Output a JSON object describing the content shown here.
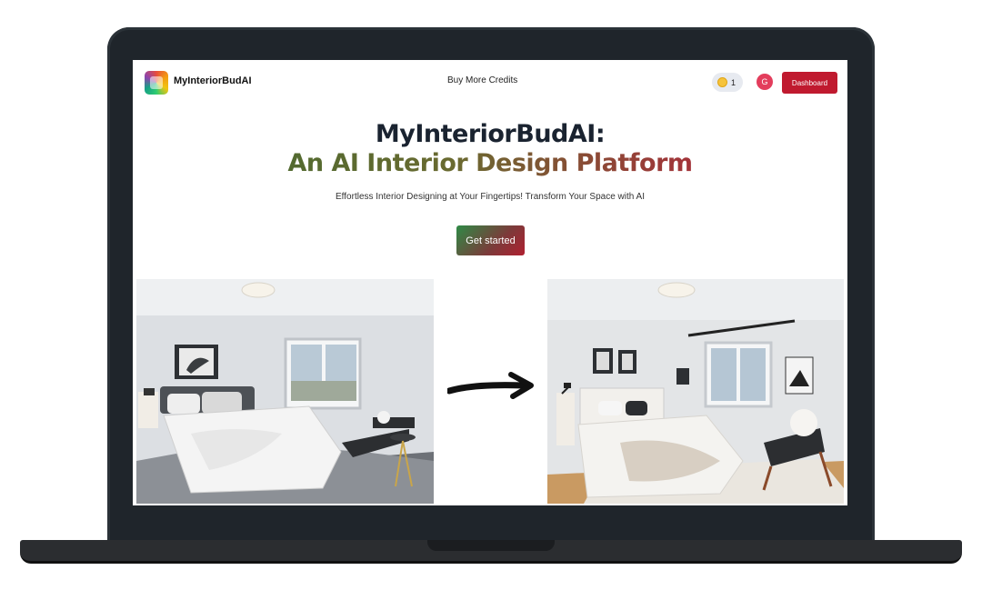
{
  "nav": {
    "brand": "MyInteriorBudAI",
    "buy_credits": "Buy More Credits",
    "credits": "1",
    "avatar_initial": "G",
    "dashboard": "Dashboard"
  },
  "hero": {
    "title": "MyInteriorBudAI:",
    "subtitle": "An AI Interior Design Platform",
    "tagline": "Effortless Interior Designing at Your Fingertips! Transform Your Space with AI",
    "cta": "Get started"
  },
  "colors": {
    "laptop_frame": "#1f252b",
    "dashboard_button": "#c01a2f",
    "avatar": "#e33d5c",
    "cta_gradient_start": "#2f8a46",
    "cta_gradient_end": "#b02030",
    "coin": "#f6c33b"
  },
  "icons": {
    "logo": "app-logo-icon",
    "coin": "coin-icon",
    "arrow": "right-arrow-icon"
  }
}
